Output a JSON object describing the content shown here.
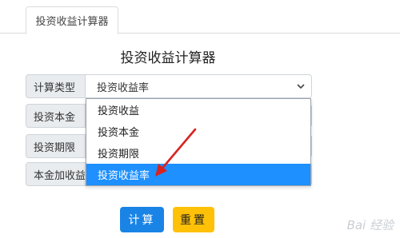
{
  "tab": {
    "label": "投资收益计算器"
  },
  "title": "投资收益计算器",
  "form": {
    "calc_type_label": "计算类型",
    "principal_label": "投资本金",
    "period_label": "投资期限",
    "total_label": "本金加收益",
    "calc_type_value": "投资收益率"
  },
  "dropdown": {
    "options": [
      "投资收益",
      "投资本金",
      "投资期限",
      "投资收益率"
    ],
    "selected_index": 3
  },
  "buttons": {
    "calculate": "计算",
    "reset": "重置"
  },
  "colors": {
    "accent": "#1a84e6",
    "selected_option": "#1e90ff",
    "warn": "#ffc107",
    "annotation_arrow": "#d9231f"
  },
  "watermark": "Bai 经验"
}
